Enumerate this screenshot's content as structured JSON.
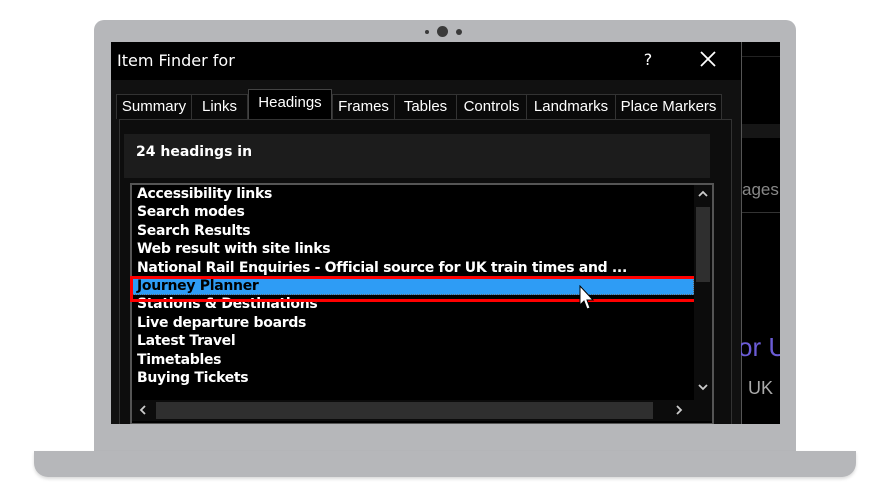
{
  "dialog": {
    "title": "Item Finder for",
    "help_label": "?",
    "close_icon": "close-icon"
  },
  "tabs": [
    {
      "label": "Summary",
      "active": false
    },
    {
      "label": "Links",
      "active": false
    },
    {
      "label": "Headings",
      "active": true
    },
    {
      "label": "Frames",
      "active": false
    },
    {
      "label": "Tables",
      "active": false
    },
    {
      "label": "Controls",
      "active": false
    },
    {
      "label": "Landmarks",
      "active": false
    },
    {
      "label": "Place Markers",
      "active": false
    }
  ],
  "headings_panel": {
    "count_label": "24 headings in",
    "items": [
      "Accessibility links",
      "Search modes",
      "Search Results",
      "Web result with site links",
      "National Rail Enquiries - Official source for UK train times and ...",
      "Journey Planner",
      "Stations & Destinations",
      "Live departure boards",
      "Latest Travel",
      "Timetables",
      "Buying Tickets"
    ],
    "selected_index": 5
  },
  "scrollbars": {
    "up_icon": "chevron-up-icon",
    "down_icon": "chevron-down-icon",
    "left_icon": "chevron-left-icon",
    "right_icon": "chevron-right-icon",
    "up_glyph": "^",
    "down_glyph": "v",
    "left_glyph": "<",
    "right_glyph": ">"
  },
  "background_page": {
    "fragment_1": "ages",
    "fragment_2": "or U",
    "fragment_3": "UK"
  },
  "colors": {
    "selection": "#2e9cf5",
    "highlight_border": "#ff0000",
    "link_purple": "#6b5cd6"
  }
}
